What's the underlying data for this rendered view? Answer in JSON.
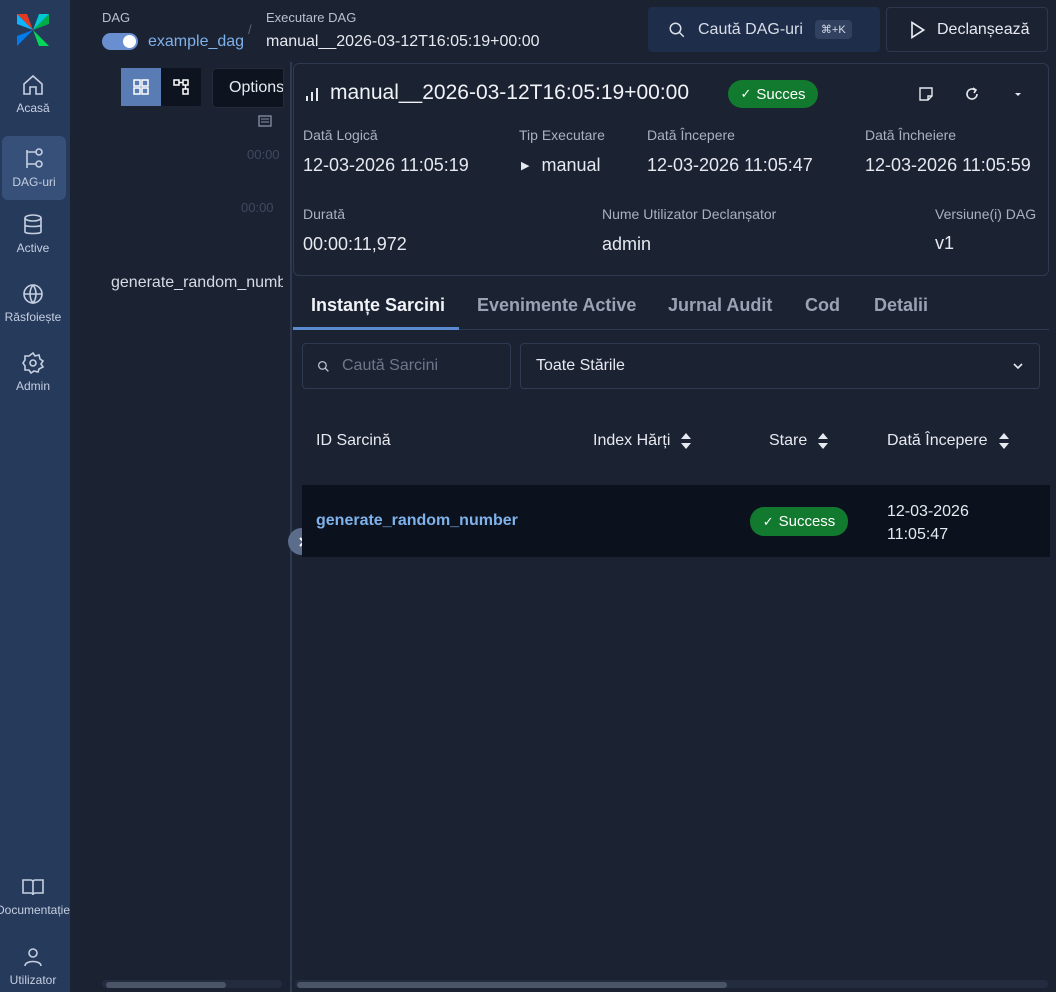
{
  "nav": {
    "items": [
      {
        "label": "Acasă",
        "icon": "home-icon"
      },
      {
        "label": "DAG-uri",
        "icon": "dag-icon"
      },
      {
        "label": "Active",
        "icon": "database-icon"
      },
      {
        "label": "Răsfoiește",
        "icon": "globe-icon"
      },
      {
        "label": "Admin",
        "icon": "gear-icon"
      },
      {
        "label": "Documentație",
        "icon": "book-icon"
      },
      {
        "label": "Utilizator",
        "icon": "user-icon"
      }
    ],
    "active": "DAG-uri"
  },
  "breadcrumb": {
    "dag_label": "DAG",
    "dag_name": "example_dag",
    "run_label": "Executare DAG",
    "run_name": "manual__2026-03-12T16:05:19+00:00"
  },
  "header": {
    "search_label": "Caută DAG-uri",
    "search_shortcut": "⌘+K",
    "trigger_label": "Declanșează"
  },
  "left_panel": {
    "options_label": "Options",
    "duration_tick_1": "00:00",
    "duration_tick_2": "00:00",
    "task_name": "generate_random_number"
  },
  "run": {
    "title": "manual__2026-03-12T16:05:19+00:00",
    "status": "Succes",
    "fields": {
      "logical_date_label": "Dată Logică",
      "logical_date": "12-03-2026 11:05:19",
      "run_type_label": "Tip Executare",
      "run_type": "manual",
      "start_date_label": "Dată Începere",
      "start_date": "12-03-2026 11:05:47",
      "end_date_label": "Dată Încheiere",
      "end_date": "12-03-2026 11:05:59",
      "duration_label": "Durată",
      "duration": "00:00:11,972",
      "triggered_by_label": "Nume Utilizator Declanșator",
      "triggered_by": "admin",
      "dag_version_label": "Versiune(i) DAG",
      "dag_version": "v1"
    }
  },
  "tabs": [
    {
      "label": "Instanțe Sarcini",
      "active": true
    },
    {
      "label": "Evenimente Active",
      "active": false
    },
    {
      "label": "Jurnal Audit",
      "active": false
    },
    {
      "label": "Cod",
      "active": false
    },
    {
      "label": "Detalii",
      "active": false
    }
  ],
  "filters": {
    "search_placeholder": "Caută Sarcini",
    "state_select": "Toate Stările"
  },
  "table": {
    "columns": [
      "ID Sarcină",
      "Index Hărți",
      "Stare",
      "Dată Începere"
    ],
    "rows": [
      {
        "task_id": "generate_random_number",
        "map_index": "",
        "state": "Success",
        "start_date_line1": "12-03-2026",
        "start_date_line2": "11:05:47"
      }
    ]
  },
  "colors": {
    "success": "#117a2e",
    "link": "#7fb1ea",
    "nav_bg": "#263a5c",
    "page_bg": "#1b2232"
  }
}
